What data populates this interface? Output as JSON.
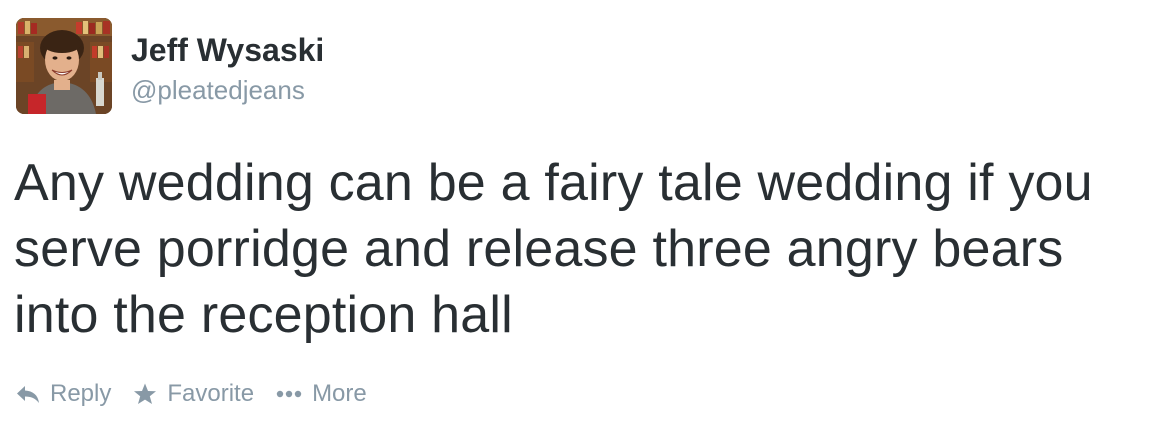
{
  "tweet": {
    "author": {
      "name": "Jeff Wysaski",
      "handle": "@pleatedjeans"
    },
    "text": "Any wedding can be a fairy tale wedding if you serve porridge and release three angry bears into the reception hall",
    "actions": {
      "reply": {
        "label": "Reply",
        "icon": "reply-icon"
      },
      "favorite": {
        "label": "Favorite",
        "icon": "star-icon"
      },
      "more": {
        "label": "More",
        "icon": "ellipsis-icon"
      }
    }
  },
  "colors": {
    "text": "#292f33",
    "muted": "#8899a6",
    "background": "#ffffff"
  }
}
